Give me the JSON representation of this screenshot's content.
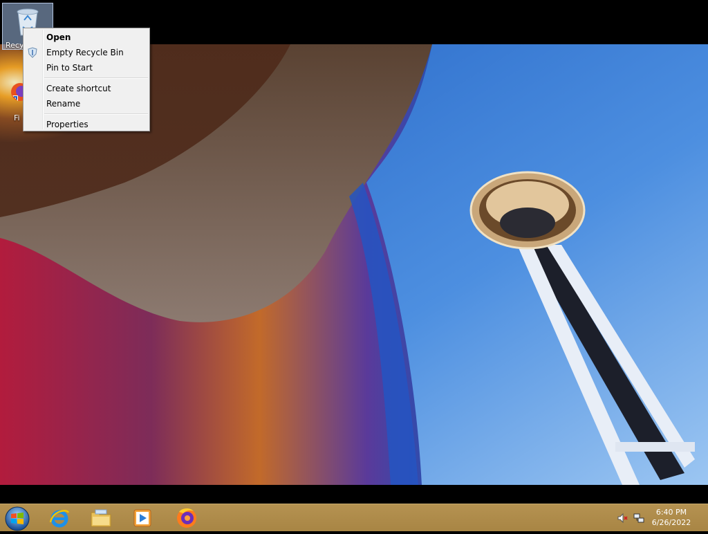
{
  "desktop": {
    "icons": [
      {
        "label": "Recyc",
        "icon": "recycle-bin-icon",
        "selected": true
      },
      {
        "label": "Fi",
        "icon": "firefox-shortcut-icon",
        "selected": false
      }
    ]
  },
  "context_menu": {
    "items": [
      {
        "label": "Open",
        "bold": true
      },
      {
        "label": "Empty Recycle Bin",
        "icon": "shield-icon"
      },
      {
        "label": "Pin to Start"
      },
      {
        "separator": true
      },
      {
        "label": "Create shortcut"
      },
      {
        "label": "Rename"
      },
      {
        "separator": true
      },
      {
        "label": "Properties"
      }
    ]
  },
  "taskbar": {
    "start": "windows-logo-icon",
    "pinned": [
      {
        "name": "Internet Explorer",
        "icon": "internet-explorer-icon"
      },
      {
        "name": "File Explorer",
        "icon": "file-explorer-icon"
      },
      {
        "name": "Windows Media Player",
        "icon": "media-player-icon"
      },
      {
        "name": "Firefox",
        "icon": "firefox-icon"
      }
    ],
    "tray": {
      "time": "6:40 PM",
      "date": "6/26/2022",
      "icons": [
        "speaker-muted-icon",
        "network-icon"
      ]
    }
  },
  "colors": {
    "taskbar": "#b08d4c",
    "menu_bg": "#f0f0f0",
    "sky": "#3f7fd4"
  }
}
